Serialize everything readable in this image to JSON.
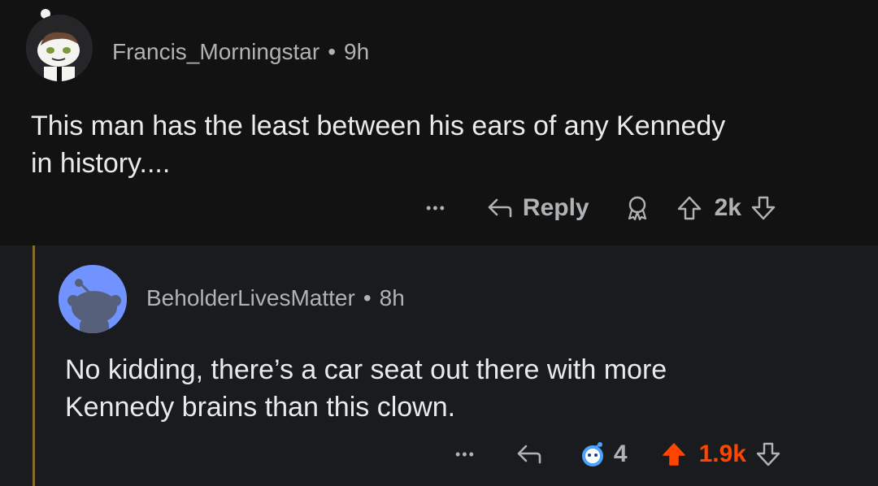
{
  "comments": [
    {
      "username": "Francis_Morningstar",
      "age": "9h",
      "text_lines": [
        "This man has the least between his ears of any Kennedy",
        "in history...."
      ],
      "more": "•••",
      "reply_label": "Reply",
      "score": "2k"
    },
    {
      "username": "BeholderLivesMatter",
      "age": "8h",
      "text_lines": [
        "No kidding, there’s a car seat out there with more",
        "Kennedy brains than this clown."
      ],
      "more": "•••",
      "award_count": "4",
      "score": "1.9k"
    }
  ],
  "separator": "•",
  "colors": {
    "upvote_active": "#ff4500",
    "thread_line": "#8a6a2c",
    "avatar2_bg": "#7193ff"
  }
}
